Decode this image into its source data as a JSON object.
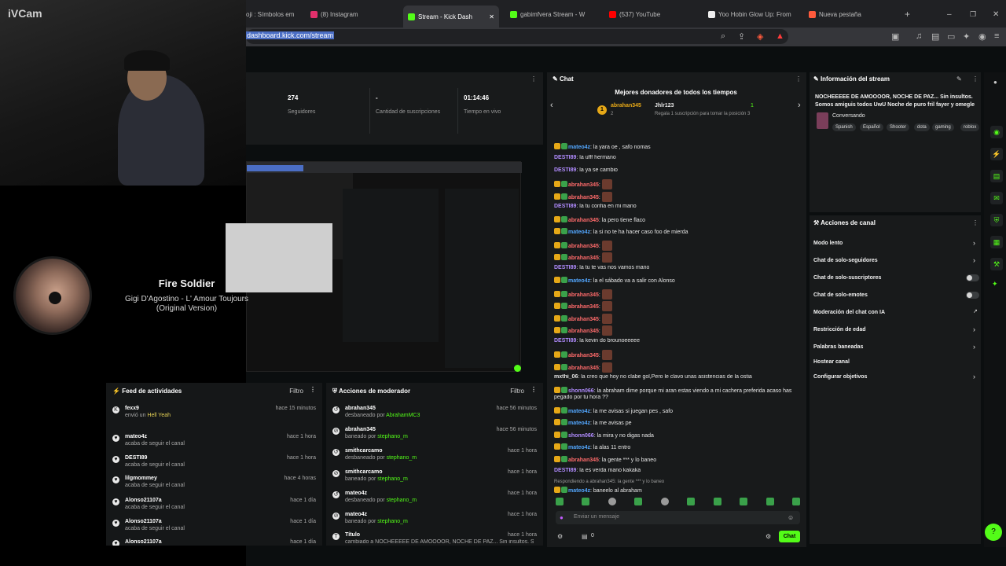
{
  "webcam": {
    "label": "iVCam"
  },
  "browser": {
    "tabs": [
      {
        "label": "oji : Símbolos em"
      },
      {
        "label": "(8) Instagram"
      },
      {
        "label": "Stream - Kick Dash"
      },
      {
        "label": "gabimfvera Stream - W"
      },
      {
        "label": "(537) YouTube"
      },
      {
        "label": "Yoo Hobin Glow Up: From"
      },
      {
        "label": "Nueva pestaña"
      }
    ],
    "url": "dashboard.kick.com/stream"
  },
  "stats": [
    {
      "value": "274",
      "label": "Seguidores"
    },
    {
      "value": "-",
      "label": "Cantidad de suscripciones"
    },
    {
      "value": "01:14:46",
      "label": "Tiempo en vivo"
    }
  ],
  "now_playing": {
    "title": "Fire Soldier",
    "artist": "Gigi D'Agostino - L' Amour Toujours (Original Version)"
  },
  "activity_feed": {
    "title": "Feed de actividades",
    "filter": "Filtro",
    "items": [
      {
        "name": "fexx9",
        "desc": "envió un",
        "gift": "Hell Yeah",
        "time": "hace 15 minutos"
      },
      {
        "name": "mateo4z",
        "desc": "acaba de seguir el canal",
        "time": "hace 1 hora"
      },
      {
        "name": "DESTI89",
        "desc": "acaba de seguir el canal",
        "time": "hace 1 hora"
      },
      {
        "name": "lilgmommey",
        "desc": "acaba de seguir el canal",
        "time": "hace 4 horas"
      },
      {
        "name": "Alonso21107a",
        "desc": "acaba de seguir el canal",
        "time": "hace 1 día"
      },
      {
        "name": "Alonso21107a",
        "desc": "acaba de seguir el canal",
        "time": "hace 1 día"
      },
      {
        "name": "Alonso21107a",
        "desc": "",
        "time": "hace 1 día"
      }
    ]
  },
  "mod_actions": {
    "title": "Acciones de moderador",
    "filter": "Filtro",
    "items": [
      {
        "name": "abrahan345",
        "action": "desbaneado por",
        "by": "AbrahamMC3",
        "time": "hace 56 minutos"
      },
      {
        "name": "abrahan345",
        "action": "baneado por",
        "by": "stephano_m",
        "time": "hace 56 minutos"
      },
      {
        "name": "smithcarcamo",
        "action": "desbaneado por",
        "by": "stephano_m",
        "time": "hace 1 hora"
      },
      {
        "name": "smithcarcamo",
        "action": "baneado por",
        "by": "stephano_m",
        "time": "hace 1 hora"
      },
      {
        "name": "mateo4z",
        "action": "desbaneado por",
        "by": "stephano_m",
        "time": "hace 1 hora"
      },
      {
        "name": "mateo4z",
        "action": "baneado por",
        "by": "stephano_m",
        "time": "hace 1 hora"
      },
      {
        "name": "Título",
        "action": "cambiado a NOCHEEEEE DE AMOOOOR, NOCHE DE PAZ... Sin insultos. Somos",
        "by": "",
        "time": "hace 1 hora"
      }
    ]
  },
  "chat": {
    "title": "Chat",
    "donors_title": "Mejores donadores de todos los tiempos",
    "donor1": "abrahan345",
    "donor1_count": "2",
    "donor2": "Jhlr123",
    "donor2_count": "1",
    "donor_note": "Regala 1 suscripción para tomar la posición 3",
    "messages": [
      {
        "user": "mateo4z",
        "text": ": la yara oe , safo nomas",
        "color": "#53a7ff"
      },
      {
        "user": "DESTI89",
        "text": ": la ufff hermano",
        "color": "#b18cff"
      },
      {
        "user": "DESTI89",
        "text": ": la ya se cambio",
        "color": "#b18cff"
      },
      {
        "user": "abrahan345",
        "text": ":",
        "color": "#ff6b6b",
        "emote": true
      },
      {
        "user": "abrahan345",
        "text": ":",
        "color": "#ff6b6b",
        "emote": true
      },
      {
        "user": "DESTI89",
        "text": ": la tu confia en mi mano",
        "color": "#b18cff"
      },
      {
        "user": "abrahan345",
        "text": ": la pero tiene flaco",
        "color": "#ff6b6b"
      },
      {
        "user": "mateo4z",
        "text": ": la si no te ha hacer caso foo de mierda",
        "color": "#53a7ff"
      },
      {
        "user": "abrahan345",
        "text": ":",
        "color": "#ff6b6b",
        "emote": true
      },
      {
        "user": "abrahan345",
        "text": ":",
        "color": "#ff6b6b",
        "emote": true
      },
      {
        "user": "DESTI89",
        "text": ": la tu te vas nos vamos mano",
        "color": "#b18cff"
      },
      {
        "user": "mateo4z",
        "text": ": la el sábado va a salir con Alonso",
        "color": "#53a7ff"
      },
      {
        "user": "abrahan345",
        "text": ":",
        "color": "#ff6b6b",
        "emote": true
      },
      {
        "user": "abrahan345",
        "text": ":",
        "color": "#ff6b6b",
        "emote": true
      },
      {
        "user": "abrahan345",
        "text": ":",
        "color": "#ff6b6b",
        "emote": true
      },
      {
        "user": "abrahan345",
        "text": ":",
        "color": "#ff6b6b",
        "emote": true
      },
      {
        "user": "DESTI89",
        "text": ": la kevin do brounoeeeee",
        "color": "#b18cff"
      },
      {
        "user": "abrahan345",
        "text": ":",
        "color": "#ff6b6b",
        "emote": true
      },
      {
        "user": "abrahan345",
        "text": ":",
        "color": "#ff6b6b",
        "emote": true
      },
      {
        "user": "mxthi_06",
        "text": ": la creo que hoy no clabe gol,Pero le clavo unas asistencias de la ostia",
        "color": "#e6e6e6"
      },
      {
        "user": "shonn066",
        "text": ": la abraham dime porque mi aran estas viendo a mi cachera preferida acaso has",
        "color": "#b18cff"
      },
      {
        "user": "",
        "text": "pegado por tu hora ??",
        "color": "#e6e6e6"
      },
      {
        "user": "mateo4z",
        "text": ": la me avisas si juegan pes , safo",
        "color": "#53a7ff"
      },
      {
        "user": "mateo4z",
        "text": ": la me avisas pe",
        "color": "#53a7ff"
      },
      {
        "user": "shonn066",
        "text": ": la mira y no digas nada",
        "color": "#b18cff"
      },
      {
        "user": "mateo4z",
        "text": ": la alas 11 entro",
        "color": "#53a7ff"
      },
      {
        "user": "abrahan345",
        "text": ": la gente *** y lo baneo",
        "color": "#ff6b6b"
      },
      {
        "user": "DESTI89",
        "text": ": la es verda mano kakaka",
        "color": "#b18cff"
      },
      {
        "user": "",
        "text": "Respondiendo a abrahan345: la gente *** y lo baneo",
        "color": "#9b9b9b"
      },
      {
        "user": "mateo4z",
        "text": ": baneelo al abraham",
        "color": "#53a7ff"
      }
    ],
    "input_placeholder": "Enviar un mensaje",
    "count": "0",
    "send": "Chat"
  },
  "stream_info": {
    "title": "Información del stream",
    "stream_title": "NOCHEEEEE DE AMOOOOR, NOCHE DE PAZ... Sin insultos. Somos amiguis todos UwU Noche de puro fril fayer y omegle",
    "category": "Conversando",
    "tags": [
      "Spanish",
      "Español",
      "Shooter",
      "dota",
      "gaming",
      "roblox"
    ]
  },
  "channel_actions": {
    "title": "Acciones de canal",
    "items": [
      "Modo lento",
      "Chat de solo-seguidores",
      "Chat de solo-suscriptores",
      "Chat de solo-emotes",
      "Moderación del chat con IA",
      "Restricción de edad",
      "Palabras baneadas",
      "Hostear canal",
      "Configurar objetivos"
    ]
  },
  "colors": {
    "accent": "#53fc18",
    "panel": "#181a1b"
  }
}
